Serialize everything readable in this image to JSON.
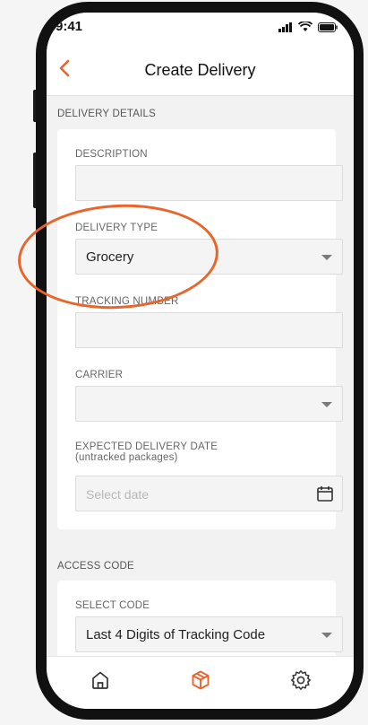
{
  "status": {
    "time": "9:41"
  },
  "nav": {
    "title": "Create Delivery",
    "back_icon": "chevron-left-icon"
  },
  "sections": {
    "delivery_details": "DELIVERY DETAILS",
    "access_code": "ACCESS CODE"
  },
  "form": {
    "description": {
      "label": "DESCRIPTION",
      "value": ""
    },
    "delivery_type": {
      "label": "DELIVERY TYPE",
      "value": "Grocery"
    },
    "tracking_number": {
      "label": "TRACKING NUMBER",
      "value": ""
    },
    "carrier": {
      "label": "CARRIER",
      "value": ""
    },
    "expected_date": {
      "label": "EXPECTED DELIVERY DATE",
      "sublabel": "(untracked packages)",
      "placeholder": "Select date"
    },
    "select_code": {
      "label": "SELECT CODE",
      "value": "Last 4 Digits of Tracking Code"
    }
  },
  "tabs": [
    {
      "icon": "home-icon"
    },
    {
      "icon": "package-icon",
      "active": true
    },
    {
      "icon": "gear-icon"
    }
  ],
  "colors": {
    "accent": "#e8662b",
    "highlight": "#e8662b"
  }
}
